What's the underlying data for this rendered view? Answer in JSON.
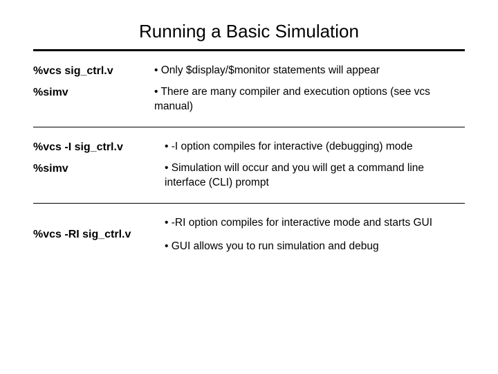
{
  "title": "Running a Basic Simulation",
  "section1": {
    "cmd1": "%vcs sig_ctrl.v",
    "desc1": "• Only $display/$monitor statements will appear",
    "cmd2": "%simv",
    "desc2": "• There are many compiler and execution options (see vcs manual)"
  },
  "section2": {
    "cmd1": "%vcs -I sig_ctrl.v",
    "desc1": "• -I option compiles for interactive (debugging) mode",
    "cmd2": "%simv",
    "desc2": "• Simulation will occur and you will get a command line interface (CLI) prompt"
  },
  "section3": {
    "cmd1": "%vcs -RI sig_ctrl.v",
    "desc1": "• -RI option compiles for interactive mode and starts GUI",
    "desc2": "• GUI allows you to run simulation and debug"
  }
}
